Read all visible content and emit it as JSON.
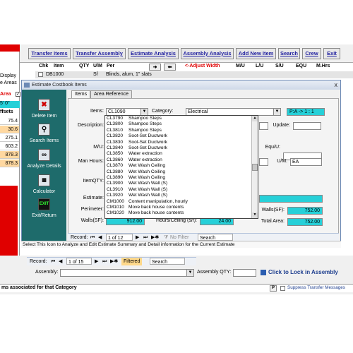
{
  "background": {
    "left_panel_texts": [
      "Display",
      "e Areas",
      "Area",
      "5' 0\"",
      "ffsets"
    ],
    "left_values": [
      "75.4",
      "30.6",
      "275.1",
      "603.2",
      "878.3",
      "878.3"
    ],
    "checkbox_checked": true
  },
  "toolbar": {
    "buttons": [
      "Transfer Items",
      "Transfer Assembly",
      "Estimate Analysis",
      "Assembly Analysis",
      "Add New Item",
      "Search",
      "Crew",
      "Exit"
    ]
  },
  "grid": {
    "headers": [
      "Chk",
      "Item",
      "QTY",
      "U/M",
      "Per",
      "M/U",
      "L/U",
      "S/U",
      "EQU",
      "M.Hrs"
    ],
    "adjust_width": "<-Adjust Width",
    "row_item": "DB1000",
    "row_um": "Sf",
    "row_desc": "Blinds, alum, 1\" slats"
  },
  "window": {
    "title": "Estimate Costbook Items",
    "close": "x",
    "tabs": [
      "Items",
      "Area Reference"
    ]
  },
  "sidebar": {
    "items": [
      {
        "label": "Delete Item",
        "icon": "delete-icon"
      },
      {
        "label": "Search Items",
        "icon": "magnifier-icon"
      },
      {
        "label": "Analyze Details",
        "icon": "binoculars-icon"
      },
      {
        "label": "Calculator",
        "icon": "calculator-icon"
      },
      {
        "label": "Exit/Return",
        "icon": "exit-icon"
      }
    ]
  },
  "form": {
    "items_label": "Items:",
    "items_value": "CL1090",
    "category_label": "Category:",
    "category_value": "Electrical",
    "pa_value": "P:A -> 1 : 1",
    "description_label": "Description:",
    "update_label": "Update:",
    "mu_label": "M/U:",
    "equ_label": "Equ/U:",
    "manhours_label": "Man Hours:",
    "um_label": "U/M:",
    "um_value": "EA",
    "itemqty_label": "ItemQTY:",
    "estimate_label": "Estimate:",
    "perimeter_label": "Perimeter:",
    "walls_label": "Walls(SF):",
    "walls_value": "912.00",
    "hours_ceiling_label": "Hours/Ceiling (s/f):",
    "hours_ceiling_value": "24.00",
    "walls_right_label": "Walls(SF):",
    "walls_right_value": "752.00",
    "total_area_label": "Total Area:",
    "total_area_value": "752.00"
  },
  "dropdown": {
    "rows": [
      {
        "code": "CL3790",
        "desc": "Shampoo Steps"
      },
      {
        "code": "CL3800",
        "desc": "Shampoo Steps"
      },
      {
        "code": "CL3810",
        "desc": "Shampoo Steps"
      },
      {
        "code": "CL3820",
        "desc": "Soot-Set Ductwork"
      },
      {
        "code": "CL3830",
        "desc": "Soot-Set Ductwork"
      },
      {
        "code": "CL3840",
        "desc": "Soot-Set Ductwork"
      },
      {
        "code": "CL3850",
        "desc": "Water extraction"
      },
      {
        "code": "CL3860",
        "desc": "Water extraction"
      },
      {
        "code": "CL3870",
        "desc": "Wet Wash Ceiling"
      },
      {
        "code": "CL3880",
        "desc": "Wet Wash Ceiling"
      },
      {
        "code": "CL3890",
        "desc": "Wet Wash Ceiling"
      },
      {
        "code": "CL3900",
        "desc": "Wet Wash Wall (S)"
      },
      {
        "code": "CL3910",
        "desc": "Wet Wash Wall (S)"
      },
      {
        "code": "CL3920",
        "desc": "Wet Wash Wall (S)"
      },
      {
        "code": "CM1000",
        "desc": "Content manipulation, hourly"
      },
      {
        "code": "CM1010",
        "desc": "Move back house contents"
      },
      {
        "code": "CM1020",
        "desc": "Move back house contents"
      }
    ]
  },
  "inner_nav": {
    "record_label": "Record:",
    "position": "1 of 12",
    "filter": "No Filter",
    "search": "Search"
  },
  "status_text": "Select This Icon to Analyze and Edit Estimate Summary and Detail information for the Current Estimate",
  "outer_nav": {
    "record_label": "Record:",
    "position": "1 of 15",
    "filter": "Filtered",
    "search": "Search"
  },
  "assembly": {
    "label": "Assembly:",
    "qty_label": "Assembly QTY:",
    "lock_text": "Click to Lock in Assembly"
  },
  "footer": {
    "left_text": "ms associated for that Category",
    "p_button": "P",
    "suppress_text": "Suppress Transfer Messages"
  }
}
